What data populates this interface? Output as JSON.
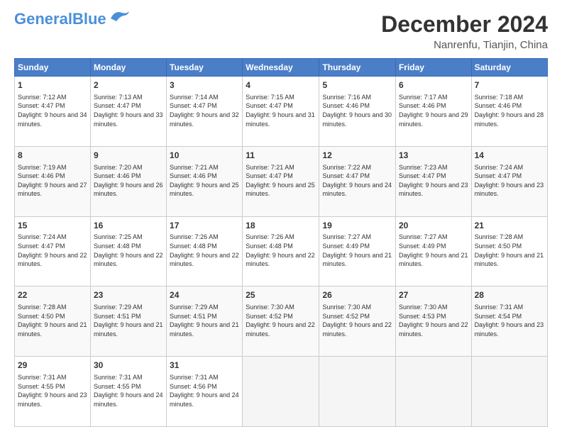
{
  "header": {
    "logo_line1": "General",
    "logo_line2": "Blue",
    "month": "December 2024",
    "location": "Nanrenfu, Tianjin, China"
  },
  "days_of_week": [
    "Sunday",
    "Monday",
    "Tuesday",
    "Wednesday",
    "Thursday",
    "Friday",
    "Saturday"
  ],
  "weeks": [
    [
      {
        "day": "1",
        "sunrise": "Sunrise: 7:12 AM",
        "sunset": "Sunset: 4:47 PM",
        "daylight": "Daylight: 9 hours and 34 minutes."
      },
      {
        "day": "2",
        "sunrise": "Sunrise: 7:13 AM",
        "sunset": "Sunset: 4:47 PM",
        "daylight": "Daylight: 9 hours and 33 minutes."
      },
      {
        "day": "3",
        "sunrise": "Sunrise: 7:14 AM",
        "sunset": "Sunset: 4:47 PM",
        "daylight": "Daylight: 9 hours and 32 minutes."
      },
      {
        "day": "4",
        "sunrise": "Sunrise: 7:15 AM",
        "sunset": "Sunset: 4:47 PM",
        "daylight": "Daylight: 9 hours and 31 minutes."
      },
      {
        "day": "5",
        "sunrise": "Sunrise: 7:16 AM",
        "sunset": "Sunset: 4:46 PM",
        "daylight": "Daylight: 9 hours and 30 minutes."
      },
      {
        "day": "6",
        "sunrise": "Sunrise: 7:17 AM",
        "sunset": "Sunset: 4:46 PM",
        "daylight": "Daylight: 9 hours and 29 minutes."
      },
      {
        "day": "7",
        "sunrise": "Sunrise: 7:18 AM",
        "sunset": "Sunset: 4:46 PM",
        "daylight": "Daylight: 9 hours and 28 minutes."
      }
    ],
    [
      {
        "day": "8",
        "sunrise": "Sunrise: 7:19 AM",
        "sunset": "Sunset: 4:46 PM",
        "daylight": "Daylight: 9 hours and 27 minutes."
      },
      {
        "day": "9",
        "sunrise": "Sunrise: 7:20 AM",
        "sunset": "Sunset: 4:46 PM",
        "daylight": "Daylight: 9 hours and 26 minutes."
      },
      {
        "day": "10",
        "sunrise": "Sunrise: 7:21 AM",
        "sunset": "Sunset: 4:46 PM",
        "daylight": "Daylight: 9 hours and 25 minutes."
      },
      {
        "day": "11",
        "sunrise": "Sunrise: 7:21 AM",
        "sunset": "Sunset: 4:47 PM",
        "daylight": "Daylight: 9 hours and 25 minutes."
      },
      {
        "day": "12",
        "sunrise": "Sunrise: 7:22 AM",
        "sunset": "Sunset: 4:47 PM",
        "daylight": "Daylight: 9 hours and 24 minutes."
      },
      {
        "day": "13",
        "sunrise": "Sunrise: 7:23 AM",
        "sunset": "Sunset: 4:47 PM",
        "daylight": "Daylight: 9 hours and 23 minutes."
      },
      {
        "day": "14",
        "sunrise": "Sunrise: 7:24 AM",
        "sunset": "Sunset: 4:47 PM",
        "daylight": "Daylight: 9 hours and 23 minutes."
      }
    ],
    [
      {
        "day": "15",
        "sunrise": "Sunrise: 7:24 AM",
        "sunset": "Sunset: 4:47 PM",
        "daylight": "Daylight: 9 hours and 22 minutes."
      },
      {
        "day": "16",
        "sunrise": "Sunrise: 7:25 AM",
        "sunset": "Sunset: 4:48 PM",
        "daylight": "Daylight: 9 hours and 22 minutes."
      },
      {
        "day": "17",
        "sunrise": "Sunrise: 7:26 AM",
        "sunset": "Sunset: 4:48 PM",
        "daylight": "Daylight: 9 hours and 22 minutes."
      },
      {
        "day": "18",
        "sunrise": "Sunrise: 7:26 AM",
        "sunset": "Sunset: 4:48 PM",
        "daylight": "Daylight: 9 hours and 22 minutes."
      },
      {
        "day": "19",
        "sunrise": "Sunrise: 7:27 AM",
        "sunset": "Sunset: 4:49 PM",
        "daylight": "Daylight: 9 hours and 21 minutes."
      },
      {
        "day": "20",
        "sunrise": "Sunrise: 7:27 AM",
        "sunset": "Sunset: 4:49 PM",
        "daylight": "Daylight: 9 hours and 21 minutes."
      },
      {
        "day": "21",
        "sunrise": "Sunrise: 7:28 AM",
        "sunset": "Sunset: 4:50 PM",
        "daylight": "Daylight: 9 hours and 21 minutes."
      }
    ],
    [
      {
        "day": "22",
        "sunrise": "Sunrise: 7:28 AM",
        "sunset": "Sunset: 4:50 PM",
        "daylight": "Daylight: 9 hours and 21 minutes."
      },
      {
        "day": "23",
        "sunrise": "Sunrise: 7:29 AM",
        "sunset": "Sunset: 4:51 PM",
        "daylight": "Daylight: 9 hours and 21 minutes."
      },
      {
        "day": "24",
        "sunrise": "Sunrise: 7:29 AM",
        "sunset": "Sunset: 4:51 PM",
        "daylight": "Daylight: 9 hours and 21 minutes."
      },
      {
        "day": "25",
        "sunrise": "Sunrise: 7:30 AM",
        "sunset": "Sunset: 4:52 PM",
        "daylight": "Daylight: 9 hours and 22 minutes."
      },
      {
        "day": "26",
        "sunrise": "Sunrise: 7:30 AM",
        "sunset": "Sunset: 4:52 PM",
        "daylight": "Daylight: 9 hours and 22 minutes."
      },
      {
        "day": "27",
        "sunrise": "Sunrise: 7:30 AM",
        "sunset": "Sunset: 4:53 PM",
        "daylight": "Daylight: 9 hours and 22 minutes."
      },
      {
        "day": "28",
        "sunrise": "Sunrise: 7:31 AM",
        "sunset": "Sunset: 4:54 PM",
        "daylight": "Daylight: 9 hours and 23 minutes."
      }
    ],
    [
      {
        "day": "29",
        "sunrise": "Sunrise: 7:31 AM",
        "sunset": "Sunset: 4:55 PM",
        "daylight": "Daylight: 9 hours and 23 minutes."
      },
      {
        "day": "30",
        "sunrise": "Sunrise: 7:31 AM",
        "sunset": "Sunset: 4:55 PM",
        "daylight": "Daylight: 9 hours and 24 minutes."
      },
      {
        "day": "31",
        "sunrise": "Sunrise: 7:31 AM",
        "sunset": "Sunset: 4:56 PM",
        "daylight": "Daylight: 9 hours and 24 minutes."
      },
      null,
      null,
      null,
      null
    ]
  ]
}
